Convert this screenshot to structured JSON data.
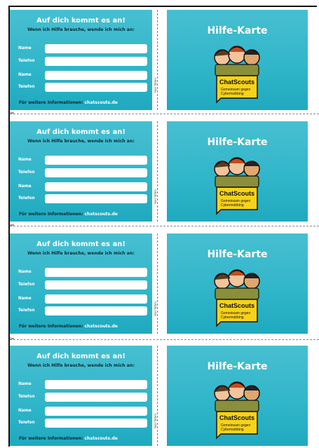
{
  "cards": [
    {
      "left_title": "Auf dich kommt es an!",
      "subtitle": "Wenn ich Hilfe brauche, wende ich mich an:",
      "labels": [
        "Name",
        "Telefon",
        "Name",
        "Telefon"
      ],
      "footer_text": "Für weitere Informationen:",
      "footer_link": "chatscouts.de",
      "fold_label": "Hier falten",
      "right_title": "Hilfe-Karte",
      "logo_name": "ChatScouts",
      "logo_tagline_1": "Gemeinsam gegen",
      "logo_tagline_2": "Cybermobbing"
    },
    {
      "left_title": "Auf dich kommt es an!",
      "subtitle": "Wenn ich Hilfe brauche, wende ich mich an:",
      "labels": [
        "Name",
        "Telefon",
        "Name",
        "Telefon"
      ],
      "footer_text": "Für weitere Informationen:",
      "footer_link": "chatscouts.de",
      "fold_label": "Hier falten",
      "right_title": "Hilfe-Karte",
      "logo_name": "ChatScouts",
      "logo_tagline_1": "Gemeinsam gegen",
      "logo_tagline_2": "Cybermobbing"
    },
    {
      "left_title": "Auf dich kommt es an!",
      "subtitle": "Wenn ich Hilfe brauche, wende ich mich an:",
      "labels": [
        "Name",
        "Telefon",
        "Name",
        "Telefon"
      ],
      "footer_text": "Für weitere Informationen:",
      "footer_link": "chatscouts.de",
      "fold_label": "Hier falten",
      "right_title": "Hilfe-Karte",
      "logo_name": "ChatScouts",
      "logo_tagline_1": "Gemeinsam gegen",
      "logo_tagline_2": "Cybermobbing"
    },
    {
      "left_title": "Auf dich kommt es an!",
      "subtitle": "Wenn ich Hilfe brauche, wende ich mich an:",
      "labels": [
        "Name",
        "Telefon",
        "Name",
        "Telefon"
      ],
      "footer_text": "Für weitere Informationen:",
      "footer_link": "chatscouts.de",
      "fold_label": "Hier falten",
      "right_title": "Hilfe-Karte",
      "logo_name": "ChatScouts",
      "logo_tagline_1": "Gemeinsam gegen",
      "logo_tagline_2": "Cybermobbing"
    }
  ],
  "scissors_icon": "scissors-icon",
  "colors": {
    "card": "#3bb8cb",
    "badge": "#f7d21a",
    "text_dark": "#0c2a33"
  }
}
